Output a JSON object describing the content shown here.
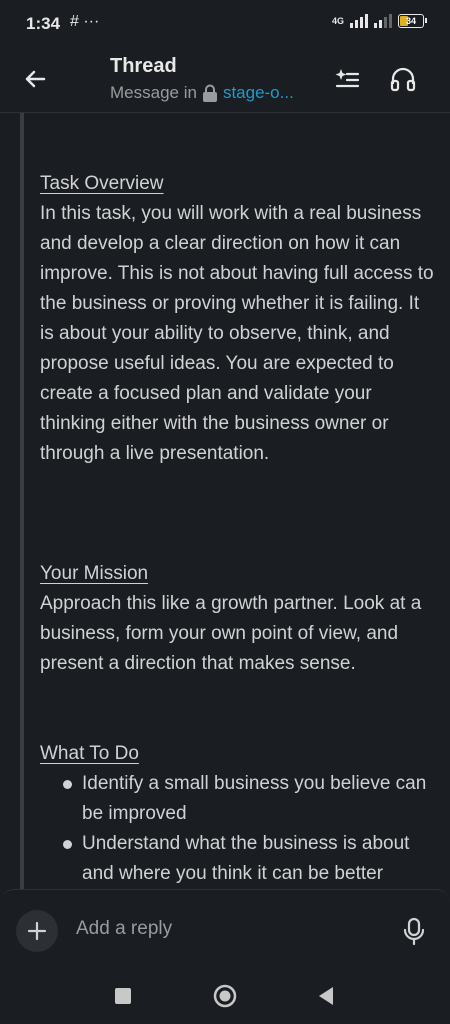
{
  "status_bar": {
    "time": "1:34",
    "notif_icons": "# ···",
    "network": "4G",
    "battery": "34"
  },
  "header": {
    "title": "Thread",
    "subtitle_prefix": "Message in",
    "channel": "stage-o..."
  },
  "message": {
    "task_overview": {
      "title": "Task Overview",
      "body": "In this task, you will work with a real business and develop a clear direction on how it can improve. This is not about having full access to the business or proving whether it is failing. It is about your ability to observe, think, and propose useful ideas. You are expected to create a focused plan and validate your thinking either with the business owner or through a live presentation."
    },
    "your_mission": {
      "title": "Your Mission",
      "body": "Approach this like a growth partner. Look at a business, form your own point of view, and present a direction that makes sense."
    },
    "what_to_do": {
      "title": "What To Do",
      "bullets": [
        "Identify a small business you believe can be improved",
        "Understand what the business is about and where you think it can be better"
      ]
    }
  },
  "composer": {
    "placeholder": "Add a reply"
  },
  "colors": {
    "background": "#1a1d21",
    "text": "#d1d2d3",
    "link": "#1d9bd1",
    "muted": "#9a9b9d"
  }
}
